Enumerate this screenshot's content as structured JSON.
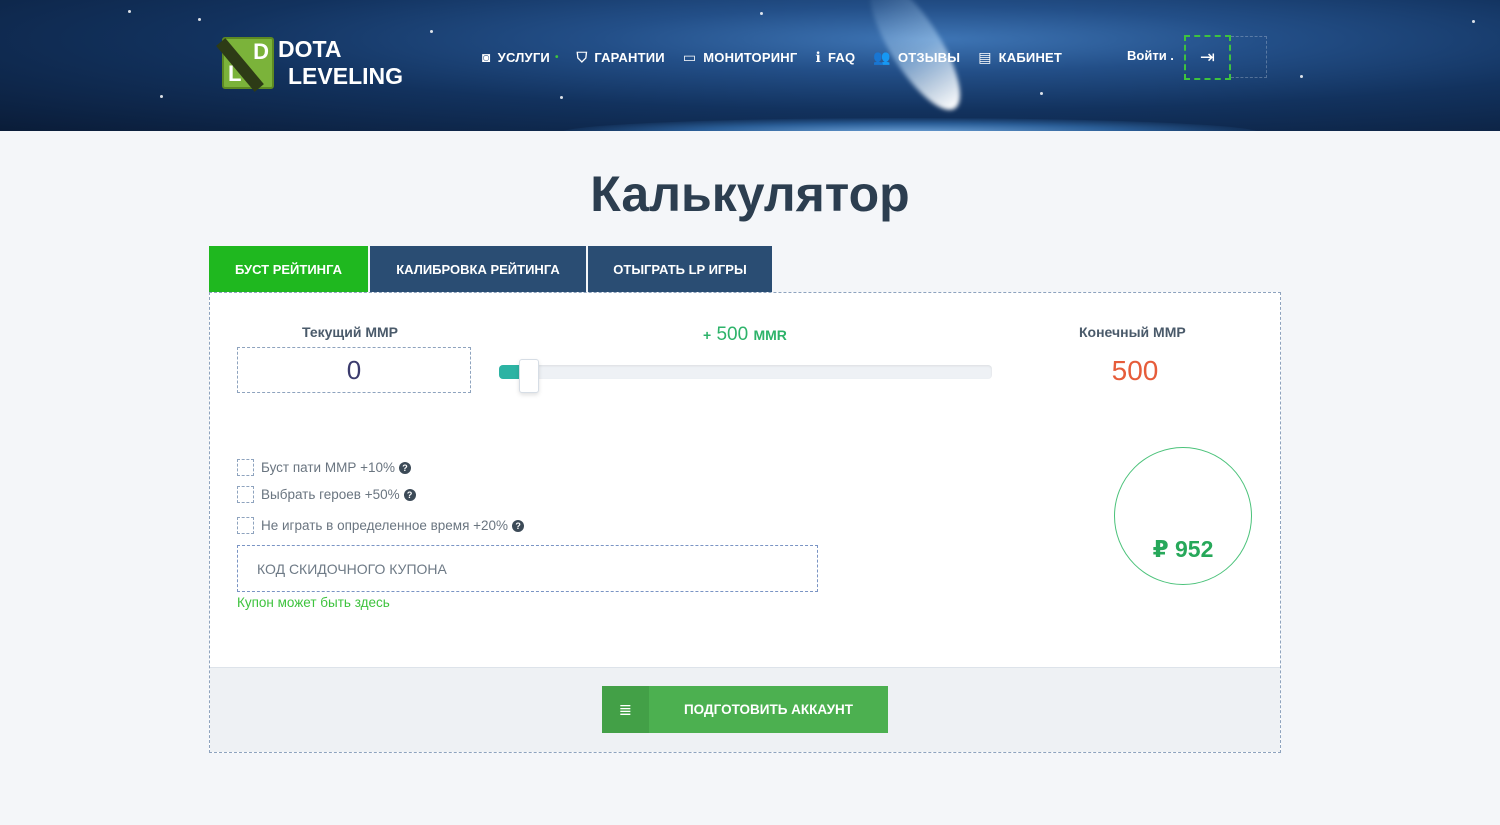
{
  "header": {
    "logo_line1": "DOTA",
    "logo_line2": "LEVELING",
    "logo_letters": [
      "D",
      "L"
    ],
    "nav": [
      {
        "label": "УСЛУГИ",
        "icon": "eye-icon",
        "glyph": "◙"
      },
      {
        "label": "ГАРАНТИИ",
        "icon": "shield-icon",
        "glyph": "⛉"
      },
      {
        "label": "МОНИТОРИНГ",
        "icon": "monitor-icon",
        "glyph": "▭"
      },
      {
        "label": "FAQ",
        "icon": "info-icon",
        "glyph": "ℹ"
      },
      {
        "label": "ОТЗЫВЫ",
        "icon": "users-icon",
        "glyph": "👥"
      },
      {
        "label": "КАБИНЕТ",
        "icon": "id-card-icon",
        "glyph": "▤"
      }
    ],
    "login_label": "Войти",
    "login_icon": "sign-in-icon"
  },
  "page": {
    "title": "Калькулятор"
  },
  "tabs": [
    {
      "label": "БУСТ РЕЙТИНГА",
      "active": true
    },
    {
      "label": "КАЛИБРОВКА РЕЙТИНГА",
      "active": false
    },
    {
      "label": "ОТЫГРАТЬ LP ИГРЫ",
      "active": false
    }
  ],
  "calculator": {
    "current_label": "Текущий ММР",
    "current_value": "0",
    "delta_prefix": "+",
    "delta_value": "500",
    "delta_unit": "ММR",
    "slider_fraction": 0.06,
    "final_label": "Конечный ММР",
    "final_value": "500",
    "options": [
      {
        "label": "Буст пати ММР +10%",
        "checked": false
      },
      {
        "label": "Выбрать героев +50%",
        "checked": false
      },
      {
        "label": "Не играть в определенное время +20%",
        "checked": false
      }
    ],
    "coupon_placeholder": "КОД СКИДОЧНОГО КУПОНА",
    "coupon_hint": "Купон может быть здесь",
    "price": "₽ 952",
    "cta_label": "ПОДГОТОВИТЬ АККАУНТ"
  },
  "colors": {
    "accent_green": "#1fb81f",
    "tab_blue": "#2a4d73",
    "final_orange": "#e65c3a",
    "price_green": "#27a85a"
  }
}
